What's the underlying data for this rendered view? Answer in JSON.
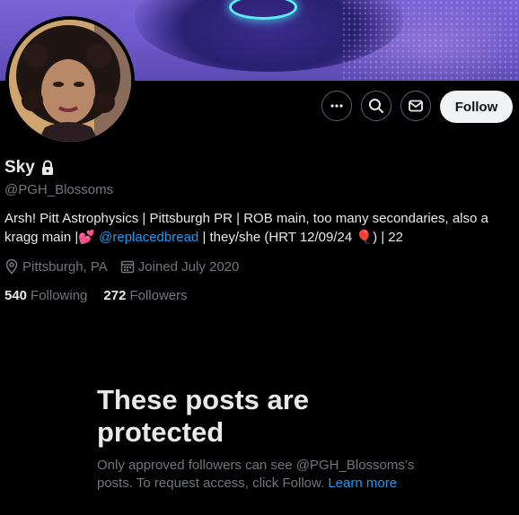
{
  "profile": {
    "name": "Sky",
    "handle": "@PGH_Blossoms",
    "bio_text": "Arsh! Pitt Astrophysics | Pittsburgh PR | ROB main, too many secondaries, also a kragg main |",
    "bio_emoji_hearts": "💕",
    "bio_mention": "@replacedbread",
    "bio_text_after": "| they/she (HRT 12/09/24",
    "bio_emoji_balloon": "🎈",
    "bio_tail": ") | 22",
    "location": "Pittsburgh, PA",
    "joined": "Joined July 2020",
    "following_count": "540",
    "following_label": "Following",
    "followers_count": "272",
    "followers_label": "Followers"
  },
  "actions": {
    "follow_label": "Follow"
  },
  "protected": {
    "title": "These posts are protected",
    "text": "Only approved followers can see @PGH_Blossoms’s posts. To request access, click Follow.",
    "learn_more": "Learn more"
  },
  "icons": {
    "more": "more-icon",
    "search": "search-icon",
    "message": "message-icon",
    "lock": "lock-icon",
    "location": "location-icon",
    "calendar": "calendar-icon"
  },
  "colors": {
    "background": "#000000",
    "text": "#e7e9ea",
    "muted": "#71767b",
    "link": "#1d9bf0",
    "follow_button": "#eff3f4"
  }
}
